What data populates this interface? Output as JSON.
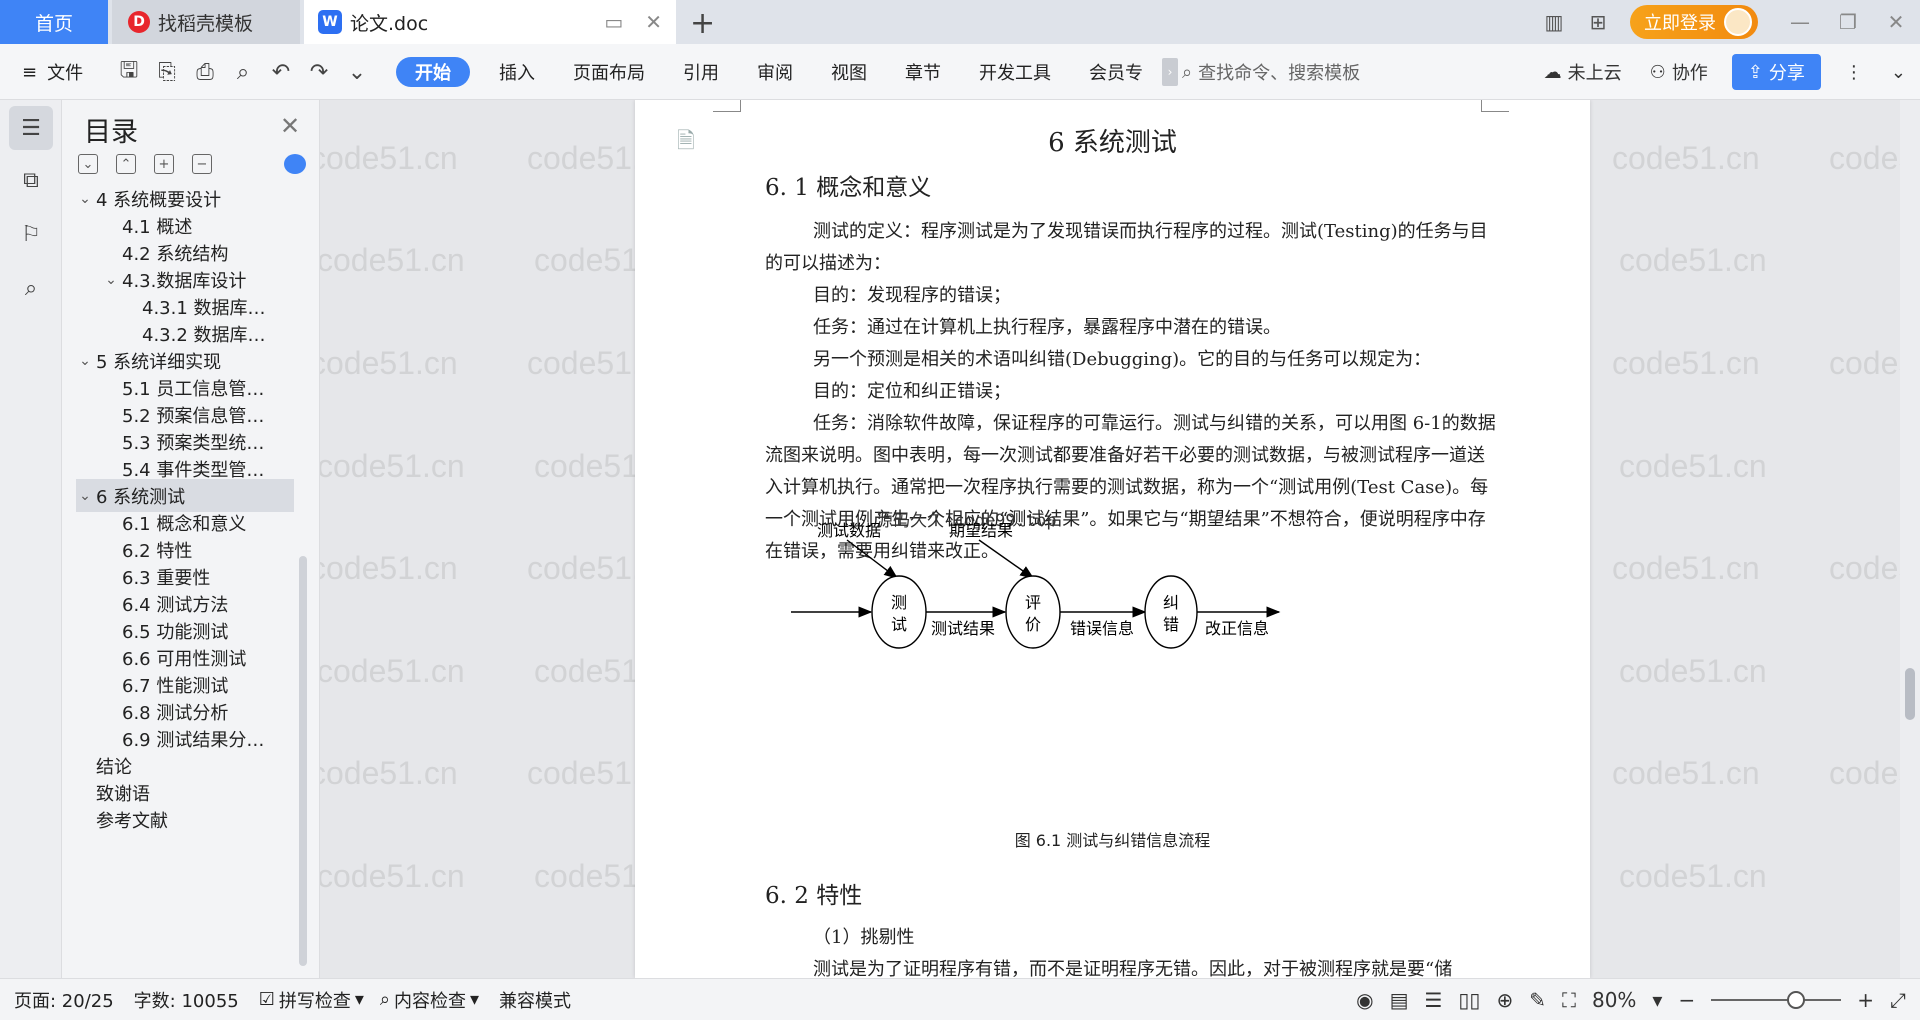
{
  "tabs": {
    "home": "首页",
    "templates": "找稻壳模板",
    "document": "论文.doc",
    "login": "立即登录"
  },
  "ribbon": {
    "file": "文件",
    "menu": [
      "开始",
      "插入",
      "页面布局",
      "引用",
      "审阅",
      "视图",
      "章节",
      "开发工具",
      "会员专"
    ],
    "search_placeholder": "查找命令、搜索模板",
    "cloud": "未上云",
    "collab": "协作",
    "share": "分享"
  },
  "toc": {
    "title": "目录",
    "items": [
      {
        "label": "4 系统概要设计",
        "level": 1,
        "expanded": true
      },
      {
        "label": "4.1 概述",
        "level": 2
      },
      {
        "label": "4.2 系统结构",
        "level": 2
      },
      {
        "label": "4.3.数据库设计",
        "level": 2,
        "expanded": true
      },
      {
        "label": "4.3.1 数据库…",
        "level": 3
      },
      {
        "label": "4.3.2 数据库…",
        "level": 3
      },
      {
        "label": "5 系统详细实现",
        "level": 1,
        "expanded": true
      },
      {
        "label": "5.1  员工信息管…",
        "level": 2
      },
      {
        "label": "5.2  预案信息管…",
        "level": 2
      },
      {
        "label": "5.3  预案类型统…",
        "level": 2
      },
      {
        "label": "5.4  事件类型管…",
        "level": 2
      },
      {
        "label": "6 系统测试",
        "level": 1,
        "expanded": true,
        "active": true
      },
      {
        "label": "6.1 概念和意义",
        "level": 2
      },
      {
        "label": "6.2 特性",
        "level": 2
      },
      {
        "label": "6.3 重要性",
        "level": 2
      },
      {
        "label": "6.4 测试方法",
        "level": 2
      },
      {
        "label": "6.5  功能测试",
        "level": 2
      },
      {
        "label": "6.6 可用性测试",
        "level": 2
      },
      {
        "label": "6.7 性能测试",
        "level": 2
      },
      {
        "label": "6.8 测试分析",
        "level": 2
      },
      {
        "label": "6.9 测试结果分…",
        "level": 2
      },
      {
        "label": "结论",
        "level": 1
      },
      {
        "label": "致谢语",
        "level": 1
      },
      {
        "label": "参考文献",
        "level": 1
      }
    ]
  },
  "doc": {
    "chapter_title": "6 系统测试",
    "section1": "6. 1 概念和意义",
    "paragraphs": [
      {
        "text": "测试的定义：程序测试是为了发现错误而执行程序的过程。测试(Testing)的任务与目的可以描述为：",
        "style": "indent"
      },
      {
        "text": "目的：发现程序的错误；",
        "style": "li2"
      },
      {
        "text": "任务：通过在计算机上执行程序，暴露程序中潜在的错误。",
        "style": "li2"
      },
      {
        "text": "另一个预测是相关的术语叫纠错(Debugging)。它的目的与任务可以规定为：",
        "style": "li2"
      },
      {
        "text": "目的：定位和纠正错误；",
        "style": "li2"
      },
      {
        "text": "任务：消除软件故障，保证程序的可靠运行。测试与纠错的关系，可以用图 6-1的数据流图来说明。图中表明，每一次测试都要准备好若干必要的测试数据，与被测试程序一道送入计算机执行。通常把一次程序执行需要的测试数据，称为一个“测试用例(Test Case)。每一个测试用例产生一个相应的“测试结果”。如果它与“期望结果”不想符合，便说明程序中存在错误，需要用纠错来改正。",
        "style": "indent"
      }
    ],
    "inline_watermark": "源码久久-code99.top",
    "diagram": {
      "input_test_data": "测试数据",
      "input_expected": "期望结果",
      "node_test": [
        "测",
        "试"
      ],
      "node_eval": [
        "评",
        "价"
      ],
      "node_fix": [
        "纠",
        "错"
      ],
      "edge_result": "测试结果",
      "edge_error": "错误信息",
      "edge_correct": "改正信息"
    },
    "caption": "图 6.1 测试与纠错信息流程",
    "section2": "6. 2 特性",
    "list_item": "（1）挑剔性",
    "next_line": "测试是为了证明程序有错，而不是证明程序无错。因此，对于被测程序就是要“储"
  },
  "watermark": "code51.cn",
  "status": {
    "page": "页面: 20/25",
    "words": "字数: 10055",
    "spell": "拼写检查",
    "content": "内容检查",
    "compat": "兼容模式",
    "zoom": "80%"
  },
  "colors": {
    "accent": "#3f84f6",
    "login": "#f28a0f"
  }
}
